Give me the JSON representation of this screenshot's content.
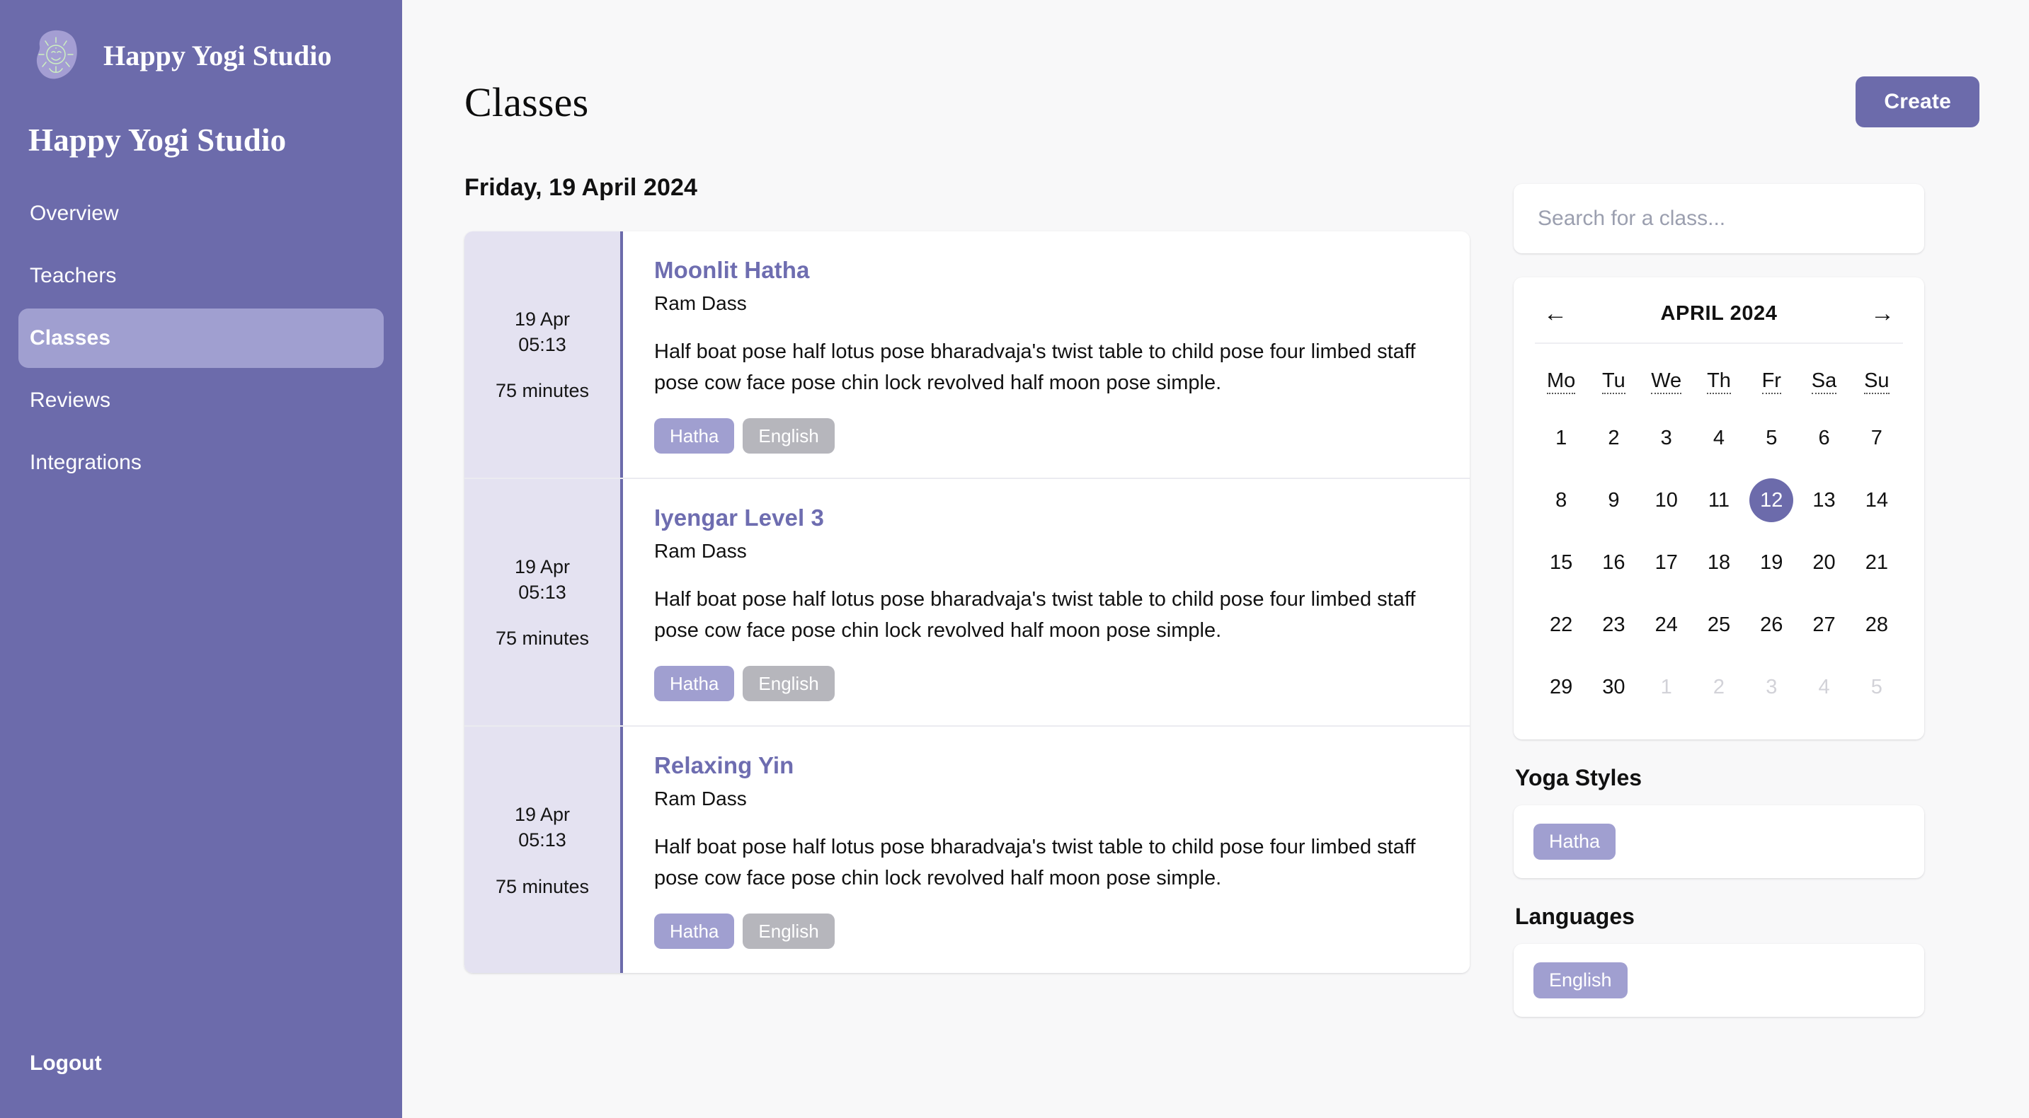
{
  "brand": {
    "logo_icon": "sun-face-icon",
    "name": "Happy Yogi Studio"
  },
  "sidebar": {
    "studio_title": "Happy Yogi Studio",
    "items": [
      {
        "label": "Overview",
        "active": false
      },
      {
        "label": "Teachers",
        "active": false
      },
      {
        "label": "Classes",
        "active": true
      },
      {
        "label": "Reviews",
        "active": false
      },
      {
        "label": "Integrations",
        "active": false
      }
    ],
    "logout_label": "Logout"
  },
  "header": {
    "title": "Classes",
    "create_label": "Create"
  },
  "main": {
    "date_heading": "Friday, 19 April 2024",
    "classes": [
      {
        "date": "19 Apr",
        "time": "05:13",
        "duration": "75 minutes",
        "title": "Moonlit Hatha",
        "teacher": "Ram Dass",
        "description": "Half boat pose half lotus pose bharadvaja's twist table to child pose four limbed staff pose cow face pose chin lock revolved half moon pose simple.",
        "style_tag": "Hatha",
        "language_tag": "English"
      },
      {
        "date": "19 Apr",
        "time": "05:13",
        "duration": "75 minutes",
        "title": "Iyengar Level 3",
        "teacher": "Ram Dass",
        "description": "Half boat pose half lotus pose bharadvaja's twist table to child pose four limbed staff pose cow face pose chin lock revolved half moon pose simple.",
        "style_tag": "Hatha",
        "language_tag": "English"
      },
      {
        "date": "19 Apr",
        "time": "05:13",
        "duration": "75 minutes",
        "title": "Relaxing Yin",
        "teacher": "Ram Dass",
        "description": "Half boat pose half lotus pose bharadvaja's twist table to child pose four limbed staff pose cow face pose chin lock revolved half moon pose simple.",
        "style_tag": "Hatha",
        "language_tag": "English"
      }
    ]
  },
  "search": {
    "value": "",
    "placeholder": "Search for a class..."
  },
  "calendar": {
    "prev_icon": "arrow-left-icon",
    "next_icon": "arrow-right-icon",
    "month_label": "APRIL 2024",
    "weekdays": [
      "Mo",
      "Tu",
      "We",
      "Th",
      "Fr",
      "Sa",
      "Su"
    ],
    "selected_day": 12,
    "weeks": [
      [
        {
          "d": "1",
          "muted": false
        },
        {
          "d": "2",
          "muted": false
        },
        {
          "d": "3",
          "muted": false
        },
        {
          "d": "4",
          "muted": false
        },
        {
          "d": "5",
          "muted": false
        },
        {
          "d": "6",
          "muted": false
        },
        {
          "d": "7",
          "muted": false
        }
      ],
      [
        {
          "d": "8",
          "muted": false
        },
        {
          "d": "9",
          "muted": false
        },
        {
          "d": "10",
          "muted": false
        },
        {
          "d": "11",
          "muted": false
        },
        {
          "d": "12",
          "muted": false,
          "selected": true
        },
        {
          "d": "13",
          "muted": false
        },
        {
          "d": "14",
          "muted": false
        }
      ],
      [
        {
          "d": "15",
          "muted": false
        },
        {
          "d": "16",
          "muted": false
        },
        {
          "d": "17",
          "muted": false
        },
        {
          "d": "18",
          "muted": false
        },
        {
          "d": "19",
          "muted": false
        },
        {
          "d": "20",
          "muted": false
        },
        {
          "d": "21",
          "muted": false
        }
      ],
      [
        {
          "d": "22",
          "muted": false
        },
        {
          "d": "23",
          "muted": false
        },
        {
          "d": "24",
          "muted": false
        },
        {
          "d": "25",
          "muted": false
        },
        {
          "d": "26",
          "muted": false
        },
        {
          "d": "27",
          "muted": false
        },
        {
          "d": "28",
          "muted": false
        }
      ],
      [
        {
          "d": "29",
          "muted": false
        },
        {
          "d": "30",
          "muted": false
        },
        {
          "d": "1",
          "muted": true
        },
        {
          "d": "2",
          "muted": true
        },
        {
          "d": "3",
          "muted": true
        },
        {
          "d": "4",
          "muted": true
        },
        {
          "d": "5",
          "muted": true
        }
      ]
    ]
  },
  "filters": {
    "yoga_styles_heading": "Yoga Styles",
    "yoga_styles": [
      "Hatha"
    ],
    "languages_heading": "Languages",
    "languages": [
      "English"
    ]
  },
  "colors": {
    "sidebar_bg": "#6c6bab",
    "accent": "#6c6bab",
    "accent_light": "#a09fd0",
    "time_col_bg": "#e4e2f1",
    "page_bg": "#f8f8f9",
    "tag_gray": "#b6b6bc",
    "logo_line": "#cdf0c0"
  }
}
